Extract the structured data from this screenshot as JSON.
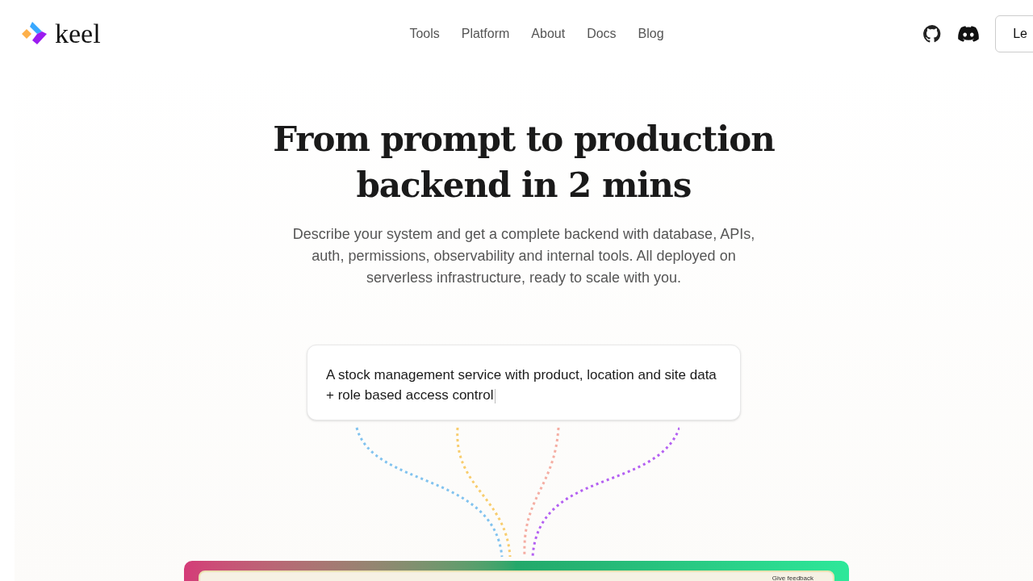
{
  "brand": {
    "name": "keel"
  },
  "nav": [
    {
      "label": "Tools"
    },
    {
      "label": "Platform"
    },
    {
      "label": "About"
    },
    {
      "label": "Docs"
    },
    {
      "label": "Blog"
    }
  ],
  "header_button": {
    "label": "Le"
  },
  "hero": {
    "title_line_1": "From prompt to production",
    "title_line_2": "backend in 2 mins",
    "subtitle": "Describe your system and get a complete backend with database, APIs, auth, permissions, observability and internal tools. All deployed on serverless infrastructure, ready to scale with you."
  },
  "prompt": {
    "value": "A stock management service with product, location and site data + role based access control"
  },
  "preview": {
    "feedback_label": "Give feedback"
  }
}
